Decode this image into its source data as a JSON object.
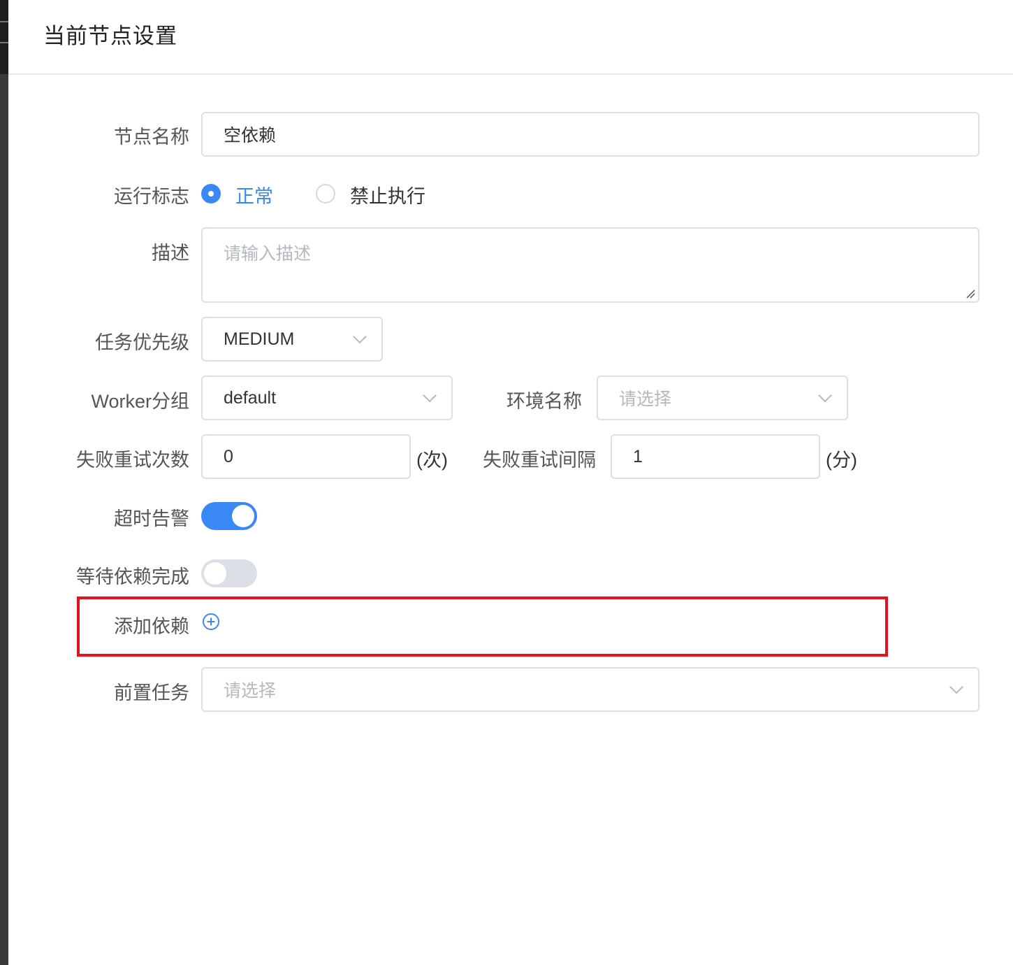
{
  "dialog": {
    "title": "当前节点设置"
  },
  "form": {
    "node_name": {
      "label": "节点名称",
      "value": "空依赖"
    },
    "run_flag": {
      "label": "运行标志",
      "options": [
        {
          "label": "正常",
          "selected": true
        },
        {
          "label": "禁止执行",
          "selected": false
        }
      ]
    },
    "description": {
      "label": "描述",
      "placeholder": "请输入描述"
    },
    "task_priority": {
      "label": "任务优先级",
      "value": "MEDIUM"
    },
    "worker_group": {
      "label": "Worker分组",
      "value": "default"
    },
    "environment_name": {
      "label": "环境名称",
      "placeholder": "请选择"
    },
    "failed_retry_times": {
      "label": "失败重试次数",
      "value": "0",
      "suffix": "(次)"
    },
    "failed_retry_interval": {
      "label": "失败重试间隔",
      "value": "1",
      "suffix": "(分)"
    },
    "timeout_alarm": {
      "label": "超时告警",
      "enabled": true
    },
    "wait_dependency_complete": {
      "label": "等待依赖完成",
      "enabled": false
    },
    "add_dependency": {
      "label": "添加依赖",
      "icon": "plus-circle-icon"
    },
    "pre_tasks": {
      "label": "前置任务",
      "placeholder": "请选择"
    }
  },
  "colors": {
    "accent": "#3a88f5",
    "highlight": "#e8101f",
    "border": "#dcdfe6",
    "placeholder": "#b4b8bf"
  }
}
